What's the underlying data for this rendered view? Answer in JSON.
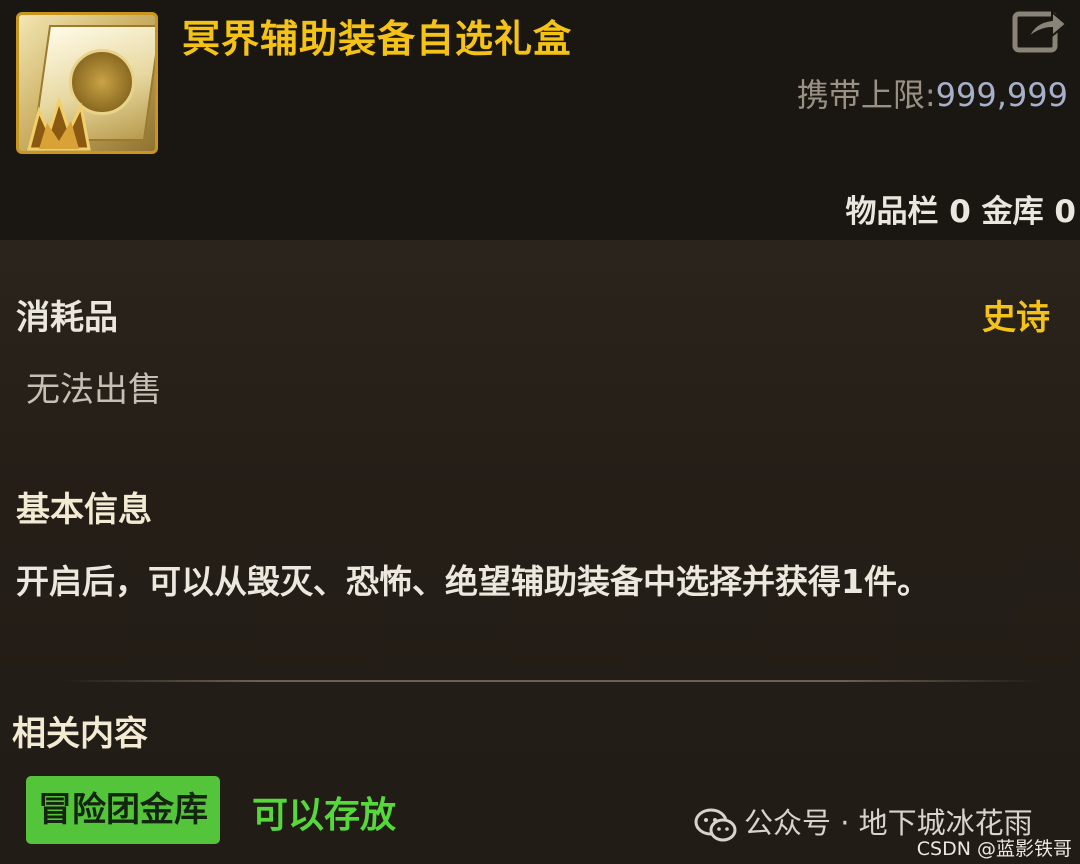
{
  "item": {
    "title": "冥界辅助装备自选礼盒",
    "icon_name": "gift-box-icon"
  },
  "carry_limit": {
    "label": "携带上限:",
    "value": "999,999"
  },
  "storage": {
    "inventory_label": "物品栏",
    "inventory_count": "0",
    "vault_label": "金库",
    "vault_count": "0"
  },
  "category": "消耗品",
  "rarity": "史诗",
  "sell_status": "无法出售",
  "basic_info": {
    "title": "基本信息",
    "description": "开启后，可以从毁灭、恐怖、绝望辅助装备中选择并获得1件。"
  },
  "related": {
    "title": "相关内容",
    "tag_label": "冒险团金库",
    "tag_status": "可以存放"
  },
  "watermark": {
    "text": "公众号 · 地下城冰花雨",
    "credit": "CSDN @蓝影铁哥"
  },
  "colors": {
    "title_gold": "#f5c216",
    "epic": "#f5c216",
    "tag_green": "#54c43a",
    "status_green": "#56d83a",
    "limit_value": "#a6b1c9"
  }
}
